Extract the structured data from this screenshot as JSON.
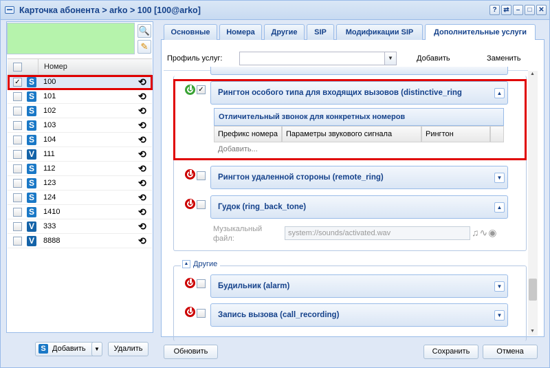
{
  "window": {
    "title": "Карточка абонента > arko > 100 [100@arko]",
    "controls": [
      "?",
      "⇄",
      "–",
      "□",
      "✕"
    ]
  },
  "left": {
    "grid_header": "Номер",
    "rows": [
      {
        "type": "S",
        "number": "100",
        "checked": true
      },
      {
        "type": "S",
        "number": "101"
      },
      {
        "type": "S",
        "number": "102"
      },
      {
        "type": "S",
        "number": "103"
      },
      {
        "type": "S",
        "number": "104"
      },
      {
        "type": "V",
        "number": "111"
      },
      {
        "type": "S",
        "number": "112"
      },
      {
        "type": "S",
        "number": "123"
      },
      {
        "type": "S",
        "number": "124"
      },
      {
        "type": "S",
        "number": "1410"
      },
      {
        "type": "V",
        "number": "333"
      },
      {
        "type": "V",
        "number": "8888"
      }
    ],
    "add_button": "Добавить",
    "delete_button": "Удалить"
  },
  "tabs": [
    "Основные",
    "Номера",
    "Другие",
    "SIP",
    "Модификации SIP",
    "Дополнительные услуги"
  ],
  "active_tab": "Дополнительные услуги",
  "profile": {
    "label": "Профиль услуг:",
    "value": "",
    "add": "Добавить",
    "replace": "Заменить"
  },
  "services": {
    "distinctive": {
      "title": "Рингтон особого типа для входящих вызовов (distinctive_ring",
      "enabled": true,
      "checked": true,
      "subtable_title": "Отличительный звонок для конкретных номеров",
      "columns": [
        "Префикс номера",
        "Параметры звукового сигнала",
        "Рингтон"
      ],
      "add_row": "Добавить..."
    },
    "remote_ring": {
      "title": "Рингтон удаленной стороны (remote_ring)"
    },
    "ring_back": {
      "title": "Гудок (ring_back_tone)",
      "music_label_1": "Музыкальный",
      "music_label_2": "файл:",
      "music_value": "system://sounds/activated.wav"
    },
    "others_legend": "Другие",
    "alarm": {
      "title": "Будильник (alarm)"
    },
    "recording": {
      "title": "Запись вызова (call_recording)"
    }
  },
  "footer": {
    "refresh": "Обновить",
    "save": "Сохранить",
    "cancel": "Отмена"
  },
  "colors": {
    "accent": "#15428b",
    "highlight": "#e00000",
    "power_on": "#3aa335",
    "power_off": "#cc0000"
  }
}
